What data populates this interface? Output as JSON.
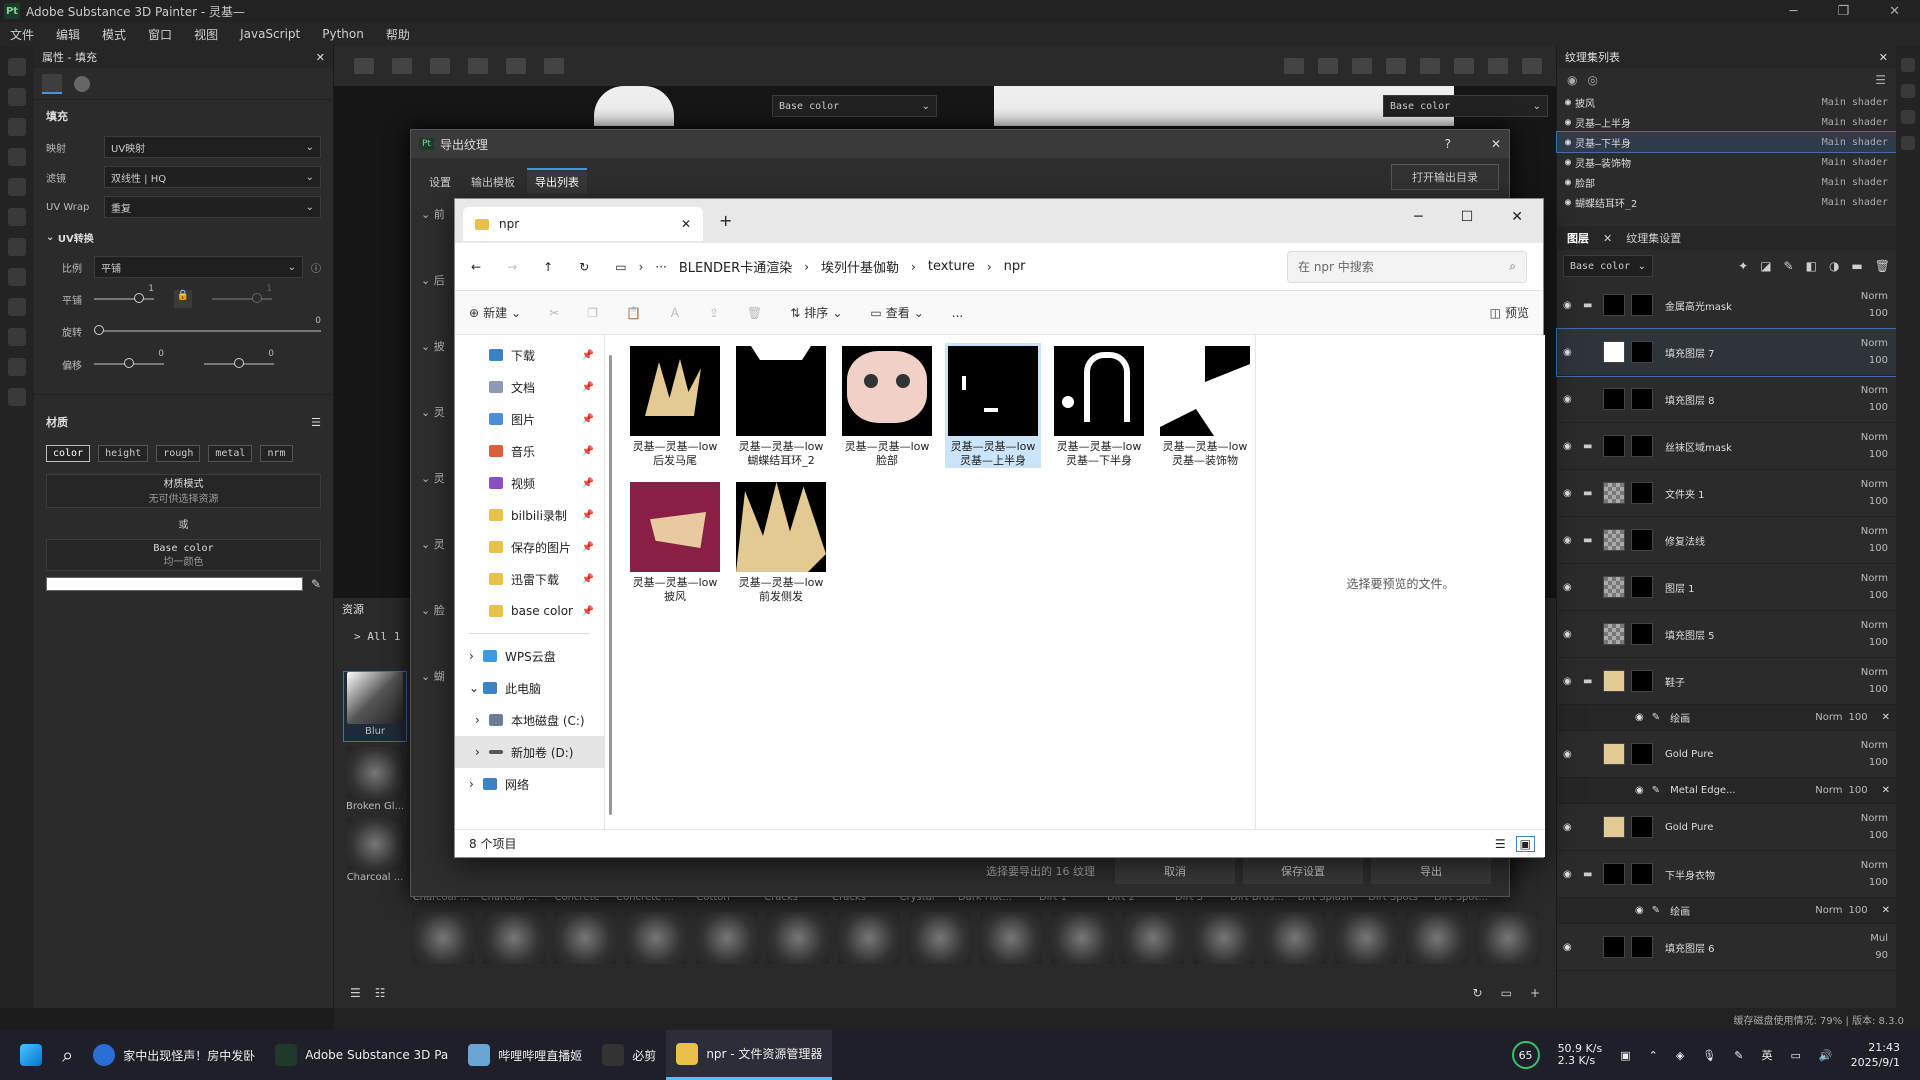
{
  "app": {
    "title": "Adobe Substance 3D Painter - 灵基—",
    "icon_label": "Pt"
  },
  "menu": [
    "文件",
    "编辑",
    "模式",
    "窗口",
    "视图",
    "JavaScript",
    "Python",
    "帮助"
  ],
  "props": {
    "panel_title": "属性 - 填充",
    "fill_section": "填充",
    "mapping_label": "映射",
    "mapping_value": "UV映射",
    "filter_label": "滤镜",
    "filter_value": "双线性 | HQ",
    "uvwrap_label": "UV Wrap",
    "uvwrap_value": "重复",
    "uv_transform": "UV转换",
    "scale_label": "比例",
    "scale_value": "平铺",
    "tile_label": "平铺",
    "tile_value": "1",
    "tile_value2": "1",
    "rotate_label": "旋转",
    "rotate_value": "0",
    "offset_label": "偏移",
    "offset_value": "0",
    "offset_value2": "0",
    "material_section": "材质",
    "channels": [
      "color",
      "height",
      "rough",
      "metal",
      "nrm"
    ],
    "material_mode": "材质模式",
    "no_resource": "无可供选择资源",
    "or": "或",
    "base_color": "Base color",
    "uniform_color": "均一颜色"
  },
  "viewport": {
    "channel_left": "Base color",
    "channel_right": "Base color"
  },
  "export_dialog": {
    "title": "导出纹理",
    "help": "?",
    "tabs": [
      "设置",
      "输出模板",
      "导出列表"
    ],
    "open_output": "打开输出目录",
    "side_labels": [
      "前",
      "后",
      "披",
      "灵",
      "灵",
      "灵",
      "脸",
      "蝴"
    ],
    "status": "选择要导出的 16 纹理",
    "cancel": "取消",
    "save_settings": "保存设置",
    "export": "导出"
  },
  "file_dialog": {
    "tab_title": "npr",
    "new_tab": "+",
    "crumbs": [
      "BLENDER卡通渲染",
      "埃列什基伽勒",
      "texture",
      "npr"
    ],
    "search_placeholder": "在 npr 中搜索",
    "new_label": "新建",
    "sort_label": "排序",
    "view_label": "查看",
    "more": "...",
    "preview_label": "预览",
    "nav": [
      {
        "label": "下载",
        "color": "#3b82c4"
      },
      {
        "label": "文档",
        "color": "#8a9bb3"
      },
      {
        "label": "图片",
        "color": "#4a8fd6"
      },
      {
        "label": "音乐",
        "color": "#d9603b"
      },
      {
        "label": "视频",
        "color": "#8b4fc2"
      },
      {
        "label": "bilbili录制",
        "color": "#e8c04a"
      },
      {
        "label": "保存的图片",
        "color": "#e8c04a"
      },
      {
        "label": "迅雷下载",
        "color": "#e8c04a"
      },
      {
        "label": "base color",
        "color": "#e8c04a"
      }
    ],
    "tree": [
      "WPS云盘",
      "此电脑",
      "本地磁盘 (C:)",
      "新加卷 (D:)",
      "网络"
    ],
    "files": [
      {
        "line1": "灵基—灵基—low",
        "line2": "后发马尾",
        "thumb": "#e3c993"
      },
      {
        "line1": "灵基—灵基—low",
        "line2": "蝴蝶结耳环_2",
        "thumb": "#000"
      },
      {
        "line1": "灵基—灵基—low",
        "line2": "脸部",
        "thumb": "#f1d0c8"
      },
      {
        "line1": "灵基—灵基—low",
        "line2": "灵基—上半身",
        "thumb": "#000"
      },
      {
        "line1": "灵基—灵基—low",
        "line2": "灵基—下半身",
        "thumb": "#000"
      },
      {
        "line1": "灵基—灵基—low",
        "line2": "灵基—装饰物",
        "thumb": "#fff"
      },
      {
        "line1": "灵基—灵基—low",
        "line2": "披风",
        "thumb": "#8a1f46"
      },
      {
        "line1": "灵基—灵基—low",
        "line2": "前发侧发",
        "thumb": "#e3c993"
      }
    ],
    "preview_hint": "选择要预览的文件。",
    "count": "8 个项目"
  },
  "assets": {
    "title": "资源",
    "filter": "All 1",
    "brushes_col": [
      {
        "label": "Blur"
      },
      {
        "label": "Broken Gl..."
      },
      {
        "label": "Charcoal ..."
      }
    ],
    "brushes_row": [
      "Charcoal ...",
      "Charcoal ...",
      "Concrete",
      "Concrete ...",
      "Cotton",
      "Cracks",
      "Cracks",
      "Crystal",
      "Dark Hat...",
      "Dirt 1",
      "Dirt 2",
      "Dirt 3",
      "Dirt Brus...",
      "Dirt Splash",
      "Dirt Spots",
      "Dirt Spot..."
    ]
  },
  "textureset": {
    "title": "纹理集列表",
    "items": [
      {
        "name": "披风",
        "shader": "Main shader",
        "sel": false
      },
      {
        "name": "灵基—上半身",
        "shader": "Main shader",
        "sel": false
      },
      {
        "name": "灵基—下半身",
        "shader": "Main shader",
        "sel": true
      },
      {
        "name": "灵基—装饰物",
        "shader": "Main shader",
        "sel": false
      },
      {
        "name": "脸部",
        "shader": "Main shader",
        "sel": false
      },
      {
        "name": "蝴蝶结耳环_2",
        "shader": "Main shader",
        "sel": false
      }
    ]
  },
  "layers": {
    "tab_layers": "图层",
    "tab_settings": "纹理集设置",
    "channel": "Base color",
    "items": [
      {
        "name": "金属高光mask",
        "mode": "Norm",
        "op": "100",
        "thumb": "black",
        "folder": true,
        "sub": false,
        "sel": false
      },
      {
        "name": "填充图层 7",
        "mode": "Norm",
        "op": "100",
        "thumb": "white",
        "folder": false,
        "sub": false,
        "sel": true
      },
      {
        "name": "填充图层 8",
        "mode": "Norm",
        "op": "100",
        "thumb": "black",
        "folder": false,
        "sub": false,
        "sel": false
      },
      {
        "name": "丝袜区域mask",
        "mode": "Norm",
        "op": "100",
        "thumb": "black",
        "folder": true,
        "sub": false,
        "sel": false
      },
      {
        "name": "文件夹 1",
        "mode": "Norm",
        "op": "100",
        "thumb": "chk",
        "folder": true,
        "sub": false,
        "sel": false
      },
      {
        "name": "修复法线",
        "mode": "Norm",
        "op": "100",
        "thumb": "chk",
        "folder": true,
        "sub": false,
        "sel": false
      },
      {
        "name": "图层 1",
        "mode": "Norm",
        "op": "100",
        "thumb": "chk",
        "folder": false,
        "sub": false,
        "sel": false
      },
      {
        "name": "填充图层 5",
        "mode": "Norm",
        "op": "100",
        "thumb": "chk",
        "folder": false,
        "sub": false,
        "sel": false
      },
      {
        "name": "鞋子",
        "mode": "Norm",
        "op": "100",
        "thumb": "gold",
        "folder": true,
        "sub": false,
        "sel": false
      },
      {
        "name": "绘画",
        "mode": "Norm",
        "op": "100",
        "thumb": "",
        "folder": false,
        "sub": true,
        "sel": false
      },
      {
        "name": "Gold Pure",
        "mode": "Norm",
        "op": "100",
        "thumb": "gold",
        "folder": false,
        "sub": false,
        "sel": false
      },
      {
        "name": "Metal Edge...",
        "mode": "Norm",
        "op": "100",
        "thumb": "",
        "folder": false,
        "sub": true,
        "sel": false
      },
      {
        "name": "Gold Pure",
        "mode": "Norm",
        "op": "100",
        "thumb": "gold",
        "folder": false,
        "sub": false,
        "sel": false
      },
      {
        "name": "下半身衣物",
        "mode": "Norm",
        "op": "100",
        "thumb": "black",
        "folder": true,
        "sub": false,
        "sel": false
      },
      {
        "name": "绘画",
        "mode": "Norm",
        "op": "100",
        "thumb": "",
        "folder": false,
        "sub": true,
        "sel": false
      },
      {
        "name": "填充图层 6",
        "mode": "Mul",
        "op": "90",
        "thumb": "black",
        "folder": false,
        "sub": false,
        "sel": false
      }
    ]
  },
  "status": {
    "cache": "缓存磁盘使用情况: 79% | 版本: 8.3.0"
  },
  "taskbar": {
    "apps": [
      "家中出现怪声！房中发卧",
      "Adobe Substance 3D Pa",
      "哔哩哔哩直播姬",
      "必剪",
      "npr - 文件资源管理器"
    ],
    "temp": "65",
    "net_up": "50.9 K/s",
    "net_down": "2.3 K/s",
    "ime": "英",
    "time": "21:43",
    "date": "2025/9/1"
  }
}
